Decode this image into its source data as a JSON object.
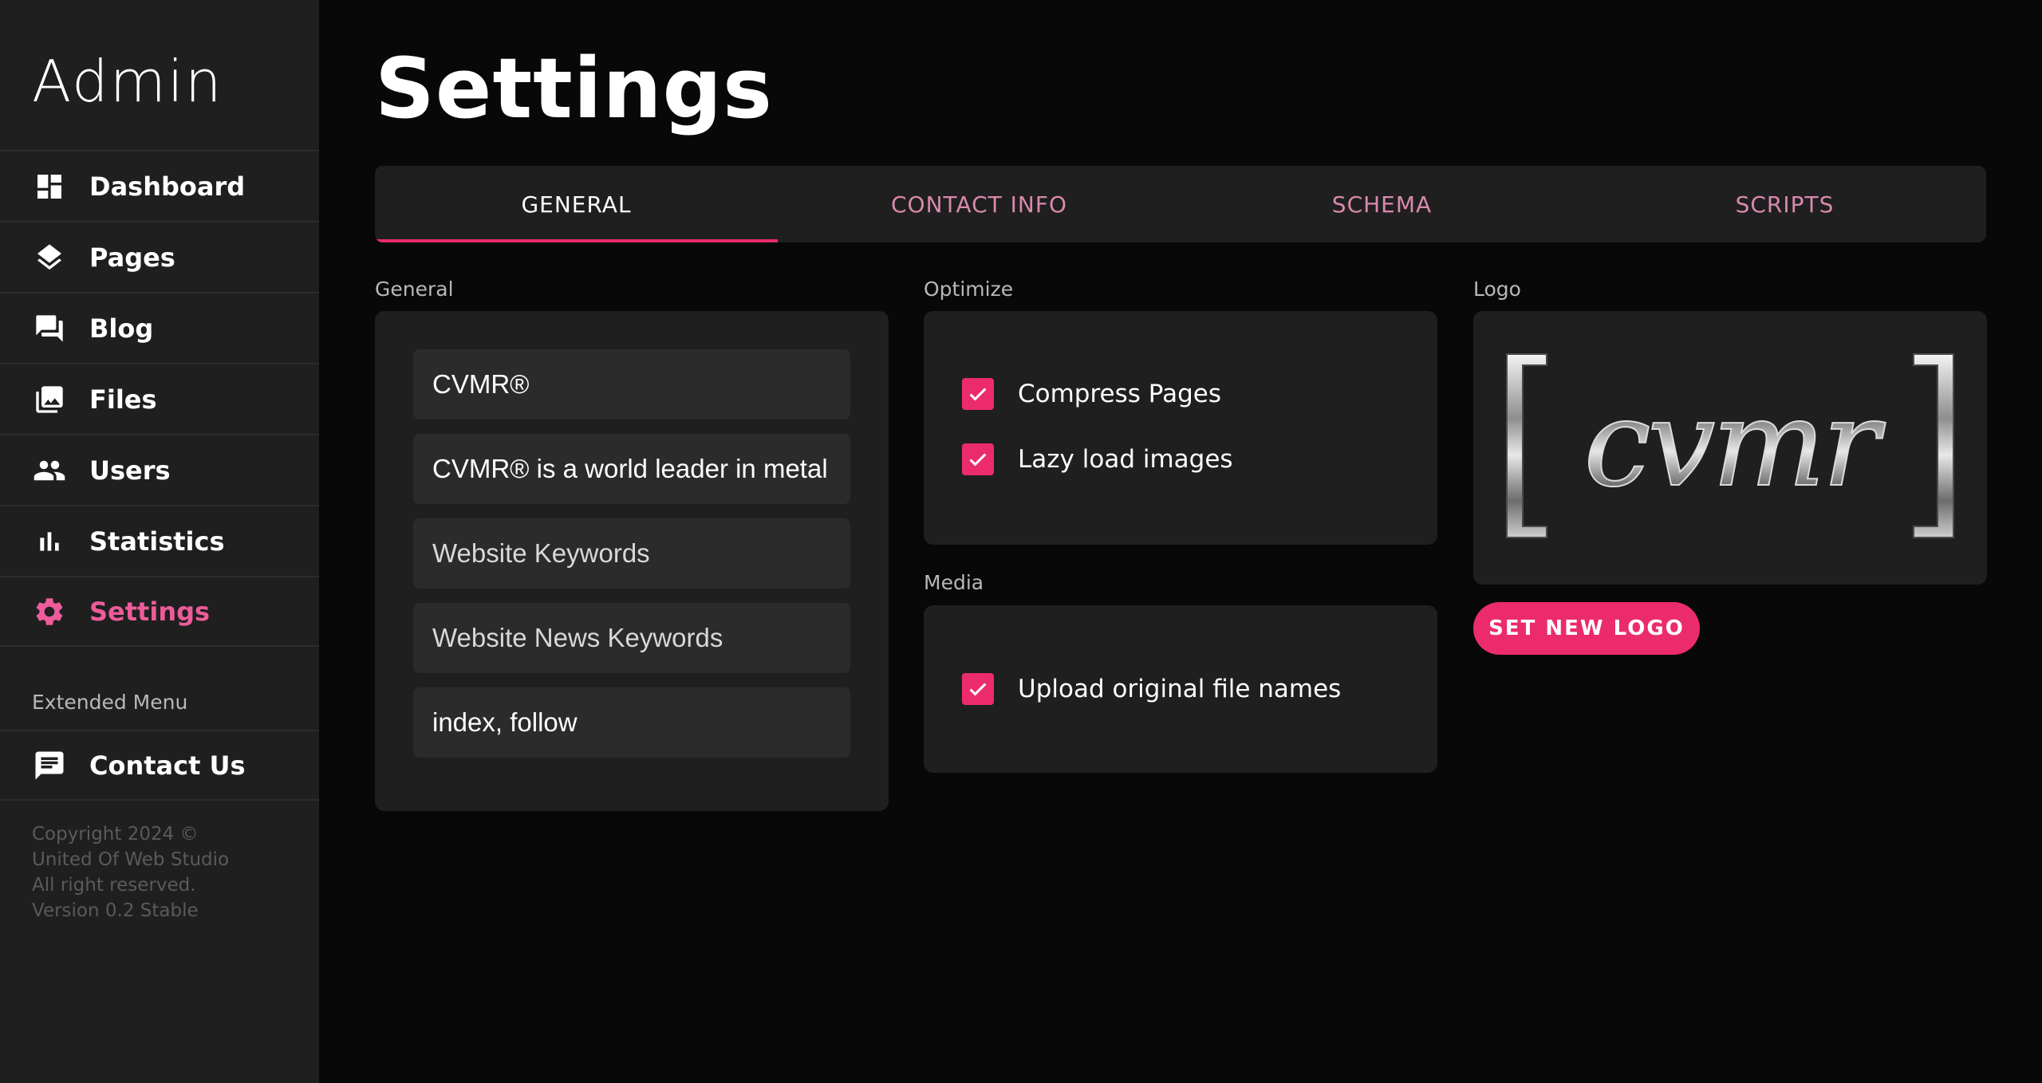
{
  "sidebar": {
    "brand": "Admin",
    "items": [
      {
        "label": "Dashboard",
        "icon": "dashboard-icon"
      },
      {
        "label": "Pages",
        "icon": "layers-icon"
      },
      {
        "label": "Blog",
        "icon": "forum-icon"
      },
      {
        "label": "Files",
        "icon": "photo-library-icon"
      },
      {
        "label": "Users",
        "icon": "people-icon"
      },
      {
        "label": "Statistics",
        "icon": "bar-chart-icon"
      },
      {
        "label": "Settings",
        "icon": "gear-icon",
        "active": true
      }
    ],
    "extended_title": "Extended Menu",
    "extended_items": [
      {
        "label": "Contact Us",
        "icon": "chat-icon"
      }
    ],
    "footer": [
      "Copyright 2024 ©",
      "United Of Web Studio",
      "All right reserved.",
      "Version 0.2 Stable"
    ]
  },
  "page_title": "Settings",
  "tabs": [
    "GENERAL",
    "CONTACT INFO",
    "SCHEMA",
    "SCRIPTS"
  ],
  "general": {
    "label": "General",
    "fields": [
      {
        "value": "CVMR®",
        "placeholder": ""
      },
      {
        "value": "CVMR® is a world leader in metal processing",
        "placeholder": ""
      },
      {
        "value": "",
        "placeholder": "Website Keywords"
      },
      {
        "value": "",
        "placeholder": "Website News Keywords"
      },
      {
        "value": "index, follow",
        "placeholder": ""
      }
    ]
  },
  "optimize": {
    "label": "Optimize",
    "options": [
      {
        "label": "Compress Pages",
        "checked": true
      },
      {
        "label": "Lazy load images",
        "checked": true
      }
    ]
  },
  "media": {
    "label": "Media",
    "options": [
      {
        "label": "Upload original file names",
        "checked": true
      }
    ]
  },
  "logo": {
    "label": "Logo",
    "image_text": "[cvmr]",
    "button": "SET NEW LOGO"
  },
  "colors": {
    "accent": "#ec2b6c",
    "active_nav": "#ec5c9a",
    "sidebar_bg": "#1f1f1f",
    "page_bg": "#080808"
  }
}
